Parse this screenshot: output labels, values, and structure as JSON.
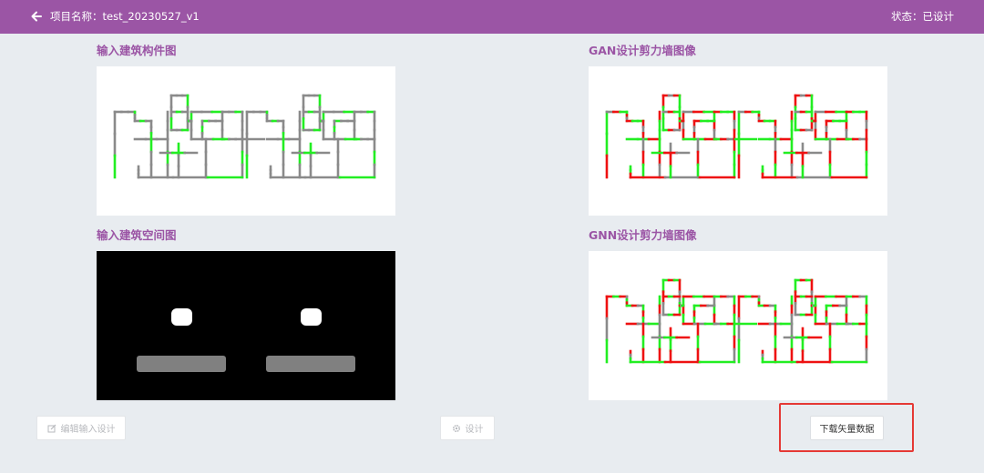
{
  "header": {
    "project_label": "项目名称：test_20230527_v1",
    "status_label": "状态：已设计",
    "background_color": "#9b55a5",
    "back_icon": "arrow-left-icon"
  },
  "panels": {
    "input_component": {
      "title": "输入建筑构件图"
    },
    "gan_shearwall": {
      "title": "GAN设计剪力墙图像"
    },
    "input_space": {
      "title": "输入建筑空间图"
    },
    "gnn_shearwall": {
      "title": "GNN设计剪力墙图像"
    }
  },
  "buttons": {
    "edit_input": {
      "label": "编辑输入设计",
      "icon": "edit-icon"
    },
    "design": {
      "label": "设计",
      "icon": "gear-icon"
    },
    "download_vector": {
      "label": "下载矢量数据"
    }
  },
  "colors": {
    "title": "#9b55a5",
    "wall_gray": "#8a8a8a",
    "wall_green": "#22ee22",
    "wall_red": "#ee1111",
    "highlight": "#e53935"
  }
}
